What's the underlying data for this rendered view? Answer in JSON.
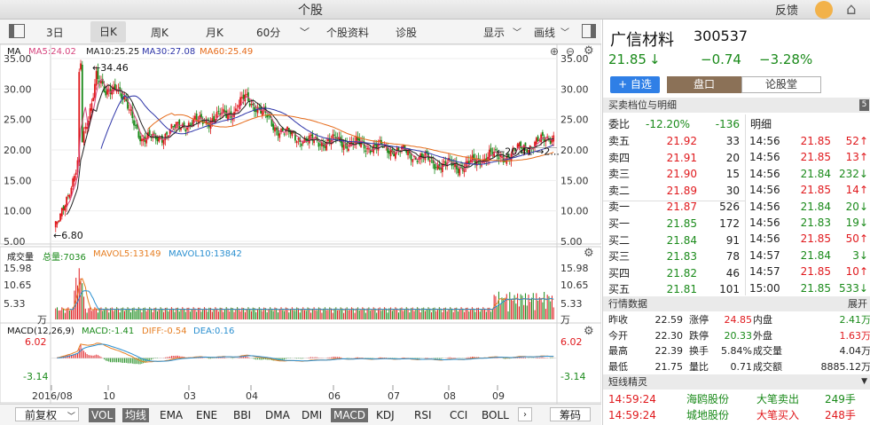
{
  "window": {
    "title": "个股",
    "feedback": "反馈"
  },
  "period_tabs": [
    "3日",
    "日K",
    "周K",
    "月K",
    "60分"
  ],
  "toolbar_items": [
    "个股资料",
    "诊股",
    "显示",
    "画线"
  ],
  "ma_legend": {
    "label": "MA",
    "ma5": "MA5:24.02",
    "ma10": "MA10:25.25",
    "ma30": "MA30:27.08",
    "ma60": "MA60:25.49"
  },
  "price_axis": [
    "35.00",
    "30.00",
    "25.00",
    "20.00",
    "15.00",
    "10.00",
    "5.00"
  ],
  "price_annotations": {
    "high": "←34.46",
    "low": "←6.80",
    "last": "←20.41 →2..."
  },
  "volume_legend": {
    "label": "成交量",
    "total": "总量:7036",
    "mavol5": "MAVOL5:13149",
    "mavol10": "MAVOL10:13842"
  },
  "volume_axis": [
    "15.98",
    "10.65",
    "5.33",
    "万"
  ],
  "macd_legend": {
    "label": "MACD(12,26,9)",
    "macd": "MACD:-1.41",
    "diff": "DIFF:-0.54",
    "dea": "DEA:0.16"
  },
  "macd_axis": [
    "6.02",
    "-3.14"
  ],
  "date_axis": [
    "2016/08",
    "10",
    "03",
    "04",
    "06",
    "07",
    "08",
    "09"
  ],
  "bottom_tabs": [
    "前复权",
    "VOL",
    "均线",
    "EMA",
    "ENE",
    "BBI",
    "DMA",
    "DMI",
    "MACD",
    "KDJ",
    "RSI",
    "CCI",
    "BOLL"
  ],
  "bottom_right": "筹码",
  "stock": {
    "name": "广信材料",
    "code": "300537",
    "price": "21.85",
    "arrow": "↓",
    "change": "−0.74",
    "pct": "−3.28%"
  },
  "buttons": {
    "add": "+ 自选",
    "pankou": "盘口",
    "lungu": "论股堂"
  },
  "orderbook": {
    "title": "买卖档位与明细",
    "badge": "5",
    "webi_label": "委比",
    "webi_pct": "-12.20%",
    "webi_val": "-136",
    "sells": [
      {
        "label": "卖五",
        "price": "21.92",
        "vol": "33"
      },
      {
        "label": "卖四",
        "price": "21.91",
        "vol": "20"
      },
      {
        "label": "卖三",
        "price": "21.90",
        "vol": "15"
      },
      {
        "label": "卖二",
        "price": "21.89",
        "vol": "30"
      },
      {
        "label": "卖一",
        "price": "21.87",
        "vol": "526"
      }
    ],
    "buys": [
      {
        "label": "买一",
        "price": "21.85",
        "vol": "172"
      },
      {
        "label": "买二",
        "price": "21.84",
        "vol": "91"
      },
      {
        "label": "买三",
        "price": "21.83",
        "vol": "78"
      },
      {
        "label": "买四",
        "price": "21.82",
        "vol": "46"
      },
      {
        "label": "买五",
        "price": "21.81",
        "vol": "101"
      }
    ]
  },
  "ticks": {
    "title": "明细",
    "rows": [
      {
        "time": "14:56",
        "price": "21.85",
        "vol": "52↑"
      },
      {
        "time": "14:56",
        "price": "21.85",
        "vol": "13↑"
      },
      {
        "time": "14:56",
        "price": "21.84",
        "vol": "232↓"
      },
      {
        "time": "14:56",
        "price": "21.85",
        "vol": "14↑"
      },
      {
        "time": "14:56",
        "price": "21.84",
        "vol": "20↓"
      },
      {
        "time": "14:56",
        "price": "21.83",
        "vol": "19↓"
      },
      {
        "time": "14:56",
        "price": "21.85",
        "vol": "50↑"
      },
      {
        "time": "14:57",
        "price": "21.84",
        "vol": "3↓"
      },
      {
        "time": "14:57",
        "price": "21.85",
        "vol": "10↑"
      },
      {
        "time": "15:00",
        "price": "21.85",
        "vol": "533↓"
      }
    ]
  },
  "quote": {
    "title": "行情数据",
    "expand": "展开",
    "rows": [
      [
        {
          "l": "昨收",
          "v": "22.59",
          "c": "k"
        },
        {
          "l": "涨停",
          "v": "24.85",
          "c": "red"
        },
        {
          "l": "内盘",
          "v": "2.41万",
          "c": "g"
        }
      ],
      [
        {
          "l": "今开",
          "v": "22.30",
          "c": "k"
        },
        {
          "l": "跌停",
          "v": "20.33",
          "c": "g"
        },
        {
          "l": "外盘",
          "v": "1.63万",
          "c": "red"
        }
      ],
      [
        {
          "l": "最高",
          "v": "22.39",
          "c": "k"
        },
        {
          "l": "换手",
          "v": "5.84%",
          "c": "k"
        },
        {
          "l": "成交量",
          "v": "4.04万",
          "c": "k"
        }
      ],
      [
        {
          "l": "最低",
          "v": "21.75",
          "c": "k"
        },
        {
          "l": "量比",
          "v": "0.71",
          "c": "k"
        },
        {
          "l": "成交额",
          "v": "8885.12万",
          "c": "k"
        }
      ]
    ]
  },
  "sprite": {
    "title": "短线精灵",
    "rows": [
      {
        "time": "14:59:24",
        "name": "海鸥股份",
        "type": "大笔卖出",
        "vol": "249手"
      },
      {
        "time": "14:59:24",
        "name": "城地股份",
        "type": "大笔买入",
        "vol": "248手"
      }
    ]
  },
  "colors": {
    "up": "#e0191d",
    "down": "#1a8a1a",
    "ma5": "#d6457e",
    "ma10": "#222222",
    "ma30": "#2e35a8",
    "ma60": "#e66b1a",
    "vol_ma5": "#e67e22",
    "vol_ma10": "#2a8fd0"
  }
}
